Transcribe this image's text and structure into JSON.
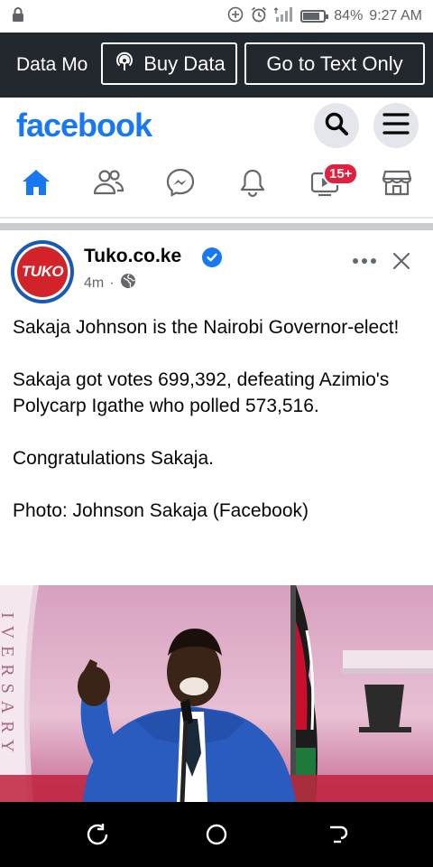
{
  "status_bar": {
    "battery": "84%",
    "battery_level": 0.84,
    "time": "9:27 AM"
  },
  "data_bar": {
    "mode_label": "Data Mo",
    "buy_data_label": "Buy Data",
    "text_only_label": "Go to Text Only"
  },
  "header": {
    "logo": "facebook"
  },
  "nav": {
    "video_badge": "15+"
  },
  "post": {
    "avatar_text": "TUKO",
    "page_name": "Tuko.co.ke",
    "time": "4m",
    "separator": "·",
    "paragraphs": [
      "Sakaja Johnson is the Nairobi Governor-elect!",
      "Sakaja got votes 699,392, defeating Azimio's Polycarp Igathe who polled 573,516.",
      "Congratulations Sakaja.",
      "Photo: Johnson Sakaja (Facebook)"
    ],
    "photo_sign_letters": "IVERSARY"
  },
  "colors": {
    "brand": "#1877f2",
    "data_bar": "#23272e",
    "badge": "#e41e3f",
    "avatar_red": "#d3232a"
  }
}
